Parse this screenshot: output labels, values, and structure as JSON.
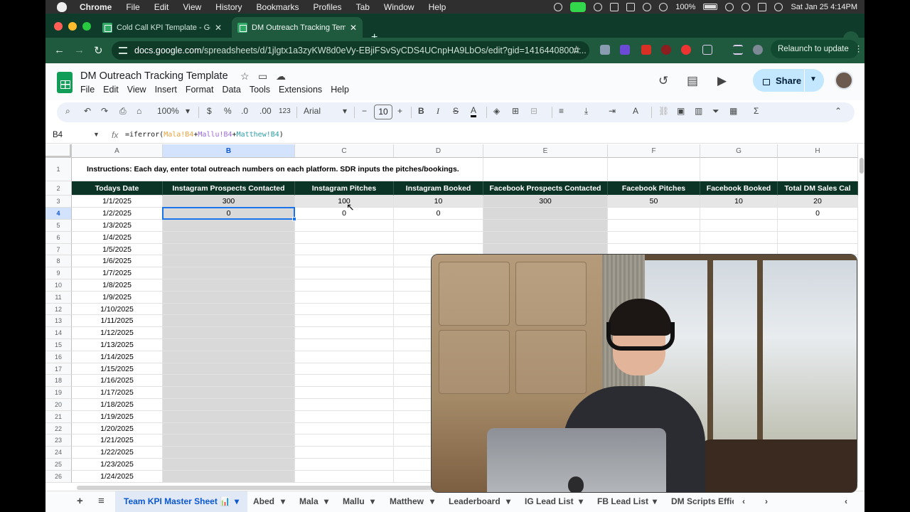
{
  "menubar": {
    "app": "Chrome",
    "items": [
      "File",
      "Edit",
      "View",
      "History",
      "Bookmarks",
      "Profiles",
      "Tab",
      "Window",
      "Help"
    ],
    "battery": "100%",
    "datetime": "Sat Jan 25  4:14PM"
  },
  "tabs": [
    {
      "title": "Cold Call KPI Template - Goo",
      "active": false
    },
    {
      "title": "DM Outreach Tracking Templ",
      "active": true
    }
  ],
  "address": {
    "host": "docs.google.com",
    "path": "/spreadsheets/d/1jlgtx1a3zyKW8d0eVy-EBjiFSvSyCDS4UCnpHA9LbOs/edit?gid=1416440800#...",
    "relaunch_label": "Relaunch to update"
  },
  "doc": {
    "title": "DM Outreach Tracking Template",
    "menu": [
      "File",
      "Edit",
      "View",
      "Insert",
      "Format",
      "Data",
      "Tools",
      "Extensions",
      "Help"
    ],
    "share_label": "Share"
  },
  "toolbar": {
    "zoom": "100%",
    "currency": "$",
    "percent": "%",
    "dec_less": ".0",
    "dec_more": ".00",
    "number_format": "123",
    "font": "Arial",
    "font_size": "10"
  },
  "formula_bar": {
    "cell_ref": "B4",
    "fx": "fx",
    "formula_start": "=iferror(",
    "ref1": "Mala!B4",
    "plus1": "+",
    "ref2": "Mallu!B4",
    "plus2": "+",
    "ref3": "Matthew!B4",
    "formula_end": ")"
  },
  "sheet": {
    "columns": [
      "A",
      "B",
      "C",
      "D",
      "E",
      "F",
      "G",
      "H"
    ],
    "selected_column": "B",
    "selected_row": "4",
    "instructions": "Instructions: Each day, enter total outreach numbers on each platform. SDR inputs the pitches/bookings.",
    "headers": [
      "Todays Date",
      "Instagram Prospects Contacted",
      "Instagram Pitches",
      "Instagram Booked",
      "Facebook Prospects Contacted",
      "Facebook Pitches",
      "Facebook Booked",
      "Total DM Sales Cal"
    ],
    "row3": [
      "1/1/2025",
      "300",
      "100",
      "10",
      "300",
      "50",
      "10",
      "20"
    ],
    "row4": [
      "1/2/2025",
      "0",
      "0",
      "0",
      "",
      "",
      "",
      "0"
    ],
    "dates": [
      "1/3/2025",
      "1/4/2025",
      "1/5/2025",
      "1/6/2025",
      "1/7/2025",
      "1/8/2025",
      "1/9/2025",
      "1/10/2025",
      "1/11/2025",
      "1/12/2025",
      "1/13/2025",
      "1/14/2025",
      "1/15/2025",
      "1/16/2025",
      "1/17/2025",
      "1/18/2025",
      "1/19/2025",
      "1/20/2025",
      "1/21/2025",
      "1/22/2025",
      "1/23/2025",
      "1/24/2025"
    ],
    "row_numbers": [
      "1",
      "2",
      "3",
      "4",
      "5",
      "6",
      "7",
      "8",
      "9",
      "10",
      "11",
      "12",
      "13",
      "14",
      "15",
      "16",
      "17",
      "18",
      "19",
      "20",
      "21",
      "22",
      "23",
      "24",
      "25",
      "26"
    ]
  },
  "sheet_tabs": {
    "active": "Team KPI Master Sheet 📊",
    "others": [
      "Abed",
      "Mala",
      "Mallu",
      "Matthew",
      "Leaderboard",
      "IG Lead List",
      "FB Lead List",
      "DM Scripts Effic"
    ]
  },
  "colors": {
    "header_bg": "#0c3426",
    "accent": "#1a73e8",
    "chrome_tab_bg": "#0f3b2b"
  }
}
